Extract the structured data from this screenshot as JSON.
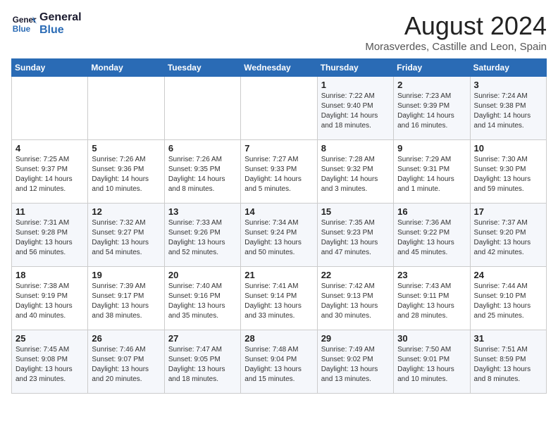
{
  "header": {
    "logo_line1": "General",
    "logo_line2": "Blue",
    "month_year": "August 2024",
    "location": "Morasverdes, Castille and Leon, Spain"
  },
  "weekdays": [
    "Sunday",
    "Monday",
    "Tuesday",
    "Wednesday",
    "Thursday",
    "Friday",
    "Saturday"
  ],
  "weeks": [
    [
      {
        "day": "",
        "info": ""
      },
      {
        "day": "",
        "info": ""
      },
      {
        "day": "",
        "info": ""
      },
      {
        "day": "",
        "info": ""
      },
      {
        "day": "1",
        "info": "Sunrise: 7:22 AM\nSunset: 9:40 PM\nDaylight: 14 hours\nand 18 minutes."
      },
      {
        "day": "2",
        "info": "Sunrise: 7:23 AM\nSunset: 9:39 PM\nDaylight: 14 hours\nand 16 minutes."
      },
      {
        "day": "3",
        "info": "Sunrise: 7:24 AM\nSunset: 9:38 PM\nDaylight: 14 hours\nand 14 minutes."
      }
    ],
    [
      {
        "day": "4",
        "info": "Sunrise: 7:25 AM\nSunset: 9:37 PM\nDaylight: 14 hours\nand 12 minutes."
      },
      {
        "day": "5",
        "info": "Sunrise: 7:26 AM\nSunset: 9:36 PM\nDaylight: 14 hours\nand 10 minutes."
      },
      {
        "day": "6",
        "info": "Sunrise: 7:26 AM\nSunset: 9:35 PM\nDaylight: 14 hours\nand 8 minutes."
      },
      {
        "day": "7",
        "info": "Sunrise: 7:27 AM\nSunset: 9:33 PM\nDaylight: 14 hours\nand 5 minutes."
      },
      {
        "day": "8",
        "info": "Sunrise: 7:28 AM\nSunset: 9:32 PM\nDaylight: 14 hours\nand 3 minutes."
      },
      {
        "day": "9",
        "info": "Sunrise: 7:29 AM\nSunset: 9:31 PM\nDaylight: 14 hours\nand 1 minute."
      },
      {
        "day": "10",
        "info": "Sunrise: 7:30 AM\nSunset: 9:30 PM\nDaylight: 13 hours\nand 59 minutes."
      }
    ],
    [
      {
        "day": "11",
        "info": "Sunrise: 7:31 AM\nSunset: 9:28 PM\nDaylight: 13 hours\nand 56 minutes."
      },
      {
        "day": "12",
        "info": "Sunrise: 7:32 AM\nSunset: 9:27 PM\nDaylight: 13 hours\nand 54 minutes."
      },
      {
        "day": "13",
        "info": "Sunrise: 7:33 AM\nSunset: 9:26 PM\nDaylight: 13 hours\nand 52 minutes."
      },
      {
        "day": "14",
        "info": "Sunrise: 7:34 AM\nSunset: 9:24 PM\nDaylight: 13 hours\nand 50 minutes."
      },
      {
        "day": "15",
        "info": "Sunrise: 7:35 AM\nSunset: 9:23 PM\nDaylight: 13 hours\nand 47 minutes."
      },
      {
        "day": "16",
        "info": "Sunrise: 7:36 AM\nSunset: 9:22 PM\nDaylight: 13 hours\nand 45 minutes."
      },
      {
        "day": "17",
        "info": "Sunrise: 7:37 AM\nSunset: 9:20 PM\nDaylight: 13 hours\nand 42 minutes."
      }
    ],
    [
      {
        "day": "18",
        "info": "Sunrise: 7:38 AM\nSunset: 9:19 PM\nDaylight: 13 hours\nand 40 minutes."
      },
      {
        "day": "19",
        "info": "Sunrise: 7:39 AM\nSunset: 9:17 PM\nDaylight: 13 hours\nand 38 minutes."
      },
      {
        "day": "20",
        "info": "Sunrise: 7:40 AM\nSunset: 9:16 PM\nDaylight: 13 hours\nand 35 minutes."
      },
      {
        "day": "21",
        "info": "Sunrise: 7:41 AM\nSunset: 9:14 PM\nDaylight: 13 hours\nand 33 minutes."
      },
      {
        "day": "22",
        "info": "Sunrise: 7:42 AM\nSunset: 9:13 PM\nDaylight: 13 hours\nand 30 minutes."
      },
      {
        "day": "23",
        "info": "Sunrise: 7:43 AM\nSunset: 9:11 PM\nDaylight: 13 hours\nand 28 minutes."
      },
      {
        "day": "24",
        "info": "Sunrise: 7:44 AM\nSunset: 9:10 PM\nDaylight: 13 hours\nand 25 minutes."
      }
    ],
    [
      {
        "day": "25",
        "info": "Sunrise: 7:45 AM\nSunset: 9:08 PM\nDaylight: 13 hours\nand 23 minutes."
      },
      {
        "day": "26",
        "info": "Sunrise: 7:46 AM\nSunset: 9:07 PM\nDaylight: 13 hours\nand 20 minutes."
      },
      {
        "day": "27",
        "info": "Sunrise: 7:47 AM\nSunset: 9:05 PM\nDaylight: 13 hours\nand 18 minutes."
      },
      {
        "day": "28",
        "info": "Sunrise: 7:48 AM\nSunset: 9:04 PM\nDaylight: 13 hours\nand 15 minutes."
      },
      {
        "day": "29",
        "info": "Sunrise: 7:49 AM\nSunset: 9:02 PM\nDaylight: 13 hours\nand 13 minutes."
      },
      {
        "day": "30",
        "info": "Sunrise: 7:50 AM\nSunset: 9:01 PM\nDaylight: 13 hours\nand 10 minutes."
      },
      {
        "day": "31",
        "info": "Sunrise: 7:51 AM\nSunset: 8:59 PM\nDaylight: 13 hours\nand 8 minutes."
      }
    ]
  ]
}
